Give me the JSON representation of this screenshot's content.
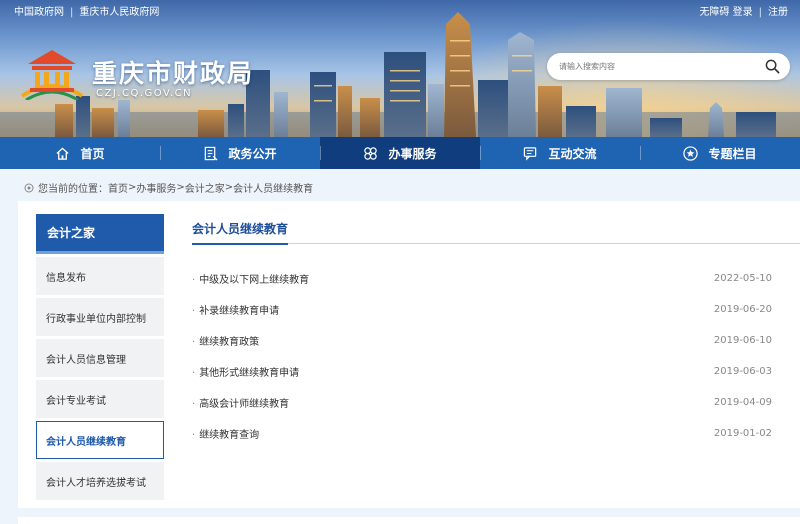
{
  "top_links": {
    "left": [
      "中国政府网",
      "重庆市人民政府网"
    ],
    "right": [
      "无障碍",
      "登录",
      "注册"
    ]
  },
  "header": {
    "title": "重庆市财政局",
    "domain": "CZJ.CQ.GOV.CN"
  },
  "search": {
    "placeholder": "请输入搜索内容",
    "icon": "search-icon"
  },
  "nav": [
    {
      "label": "首页",
      "icon": "home-icon"
    },
    {
      "label": "政务公开",
      "icon": "document-icon"
    },
    {
      "label": "办事服务",
      "icon": "service-icon"
    },
    {
      "label": "互动交流",
      "icon": "chat-icon"
    },
    {
      "label": "专题栏目",
      "icon": "star-icon"
    }
  ],
  "breadcrumb": {
    "prefix": "您当前的位置：",
    "items": [
      "首页",
      "办事服务",
      "会计之家",
      "会计人员继续教育"
    ],
    "separator": ">"
  },
  "sidebar": {
    "title": "会计之家",
    "items": [
      "信息发布",
      "行政事业单位内部控制",
      "会计人员信息管理",
      "会计专业考试",
      "会计人员继续教育",
      "会计人才培养选拔考试"
    ],
    "active": "会计人员继续教育"
  },
  "content": {
    "title": "会计人员继续教育",
    "articles": [
      {
        "title": "中级及以下网上继续教育",
        "date": "2022-05-10"
      },
      {
        "title": "补录继续教育申请",
        "date": "2019-06-20"
      },
      {
        "title": "继续教育政策",
        "date": "2019-06-10"
      },
      {
        "title": "其他形式继续教育申请",
        "date": "2019-06-03"
      },
      {
        "title": "高级会计师继续教育",
        "date": "2019-04-09"
      },
      {
        "title": "继续教育查询",
        "date": "2019-01-02"
      }
    ]
  },
  "colors": {
    "nav_blue": "#1f63b3",
    "nav_active": "#0f3d7d",
    "accent": "#1f5aab"
  }
}
